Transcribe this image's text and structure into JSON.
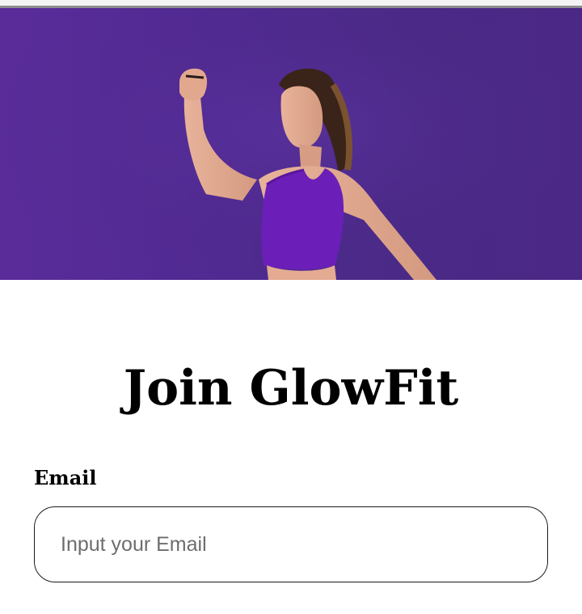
{
  "hero": {
    "image_description_icon": "woman-athlete-raising-fist-image",
    "background_color": "#512a92"
  },
  "signup": {
    "title": "Join GlowFit",
    "email_label": "Email",
    "email_placeholder": "Input your Email",
    "email_value": ""
  }
}
